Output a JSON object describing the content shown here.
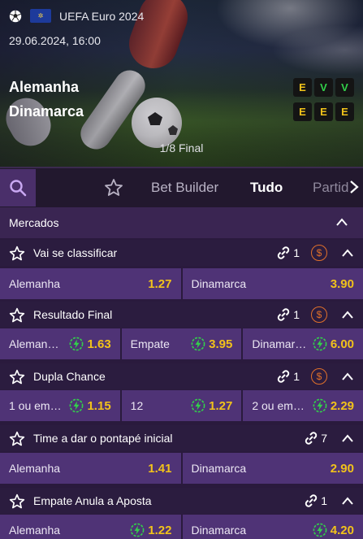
{
  "event": {
    "competition": "UEFA Euro 2024",
    "datetime": "29.06.2024, 16:00",
    "home": "Alemanha",
    "away": "Dinamarca",
    "stage": "1/8 Final",
    "home_form": [
      "E",
      "V",
      "V"
    ],
    "away_form": [
      "E",
      "E",
      "E"
    ]
  },
  "tabs": {
    "builder": "Bet Builder",
    "all": "Tudo",
    "partial": "Partid"
  },
  "markets_title": "Mercados",
  "sections": [
    {
      "title": "Vai se classificar",
      "link_count": "1",
      "has_coin": true,
      "odds": [
        {
          "label": "Alemanha",
          "value": "1.27"
        },
        {
          "label": "Dinamarca",
          "value": "3.90"
        }
      ]
    },
    {
      "title": "Resultado Final",
      "link_count": "1",
      "has_coin": true,
      "odds": [
        {
          "label": "Aleman…",
          "value": "1.63",
          "boost": true
        },
        {
          "label": "Empate",
          "value": "3.95",
          "boost": true
        },
        {
          "label": "Dinamar…",
          "value": "6.00",
          "boost": true
        }
      ]
    },
    {
      "title": "Dupla Chance",
      "link_count": "1",
      "has_coin": true,
      "odds": [
        {
          "label": "1 ou em…",
          "value": "1.15",
          "boost": true
        },
        {
          "label": "12",
          "value": "1.27",
          "boost": true
        },
        {
          "label": "2 ou em…",
          "value": "2.29",
          "boost": true
        }
      ]
    },
    {
      "title": "Time a dar o pontapé inicial",
      "link_count": "7",
      "has_coin": false,
      "odds": [
        {
          "label": "Alemanha",
          "value": "1.41"
        },
        {
          "label": "Dinamarca",
          "value": "2.90"
        }
      ]
    },
    {
      "title": "Empate Anula a Aposta",
      "link_count": "1",
      "has_coin": false,
      "odds": [
        {
          "label": "Alemanha",
          "value": "1.22",
          "boost": true
        },
        {
          "label": "Dinamarca",
          "value": "4.20",
          "boost": true
        }
      ]
    }
  ],
  "colors": {
    "odds": "#f1c21b",
    "cell": "#4f3376",
    "coin": "#e0702a",
    "win": "#32d14a",
    "draw": "#f0c21a"
  },
  "icons": [
    "soccer-ball-icon",
    "eu-flag-icon",
    "search-icon",
    "star-icon",
    "chevron-right-icon",
    "chevron-up-icon",
    "link-icon",
    "cashout-coin-icon",
    "boost-icon"
  ]
}
